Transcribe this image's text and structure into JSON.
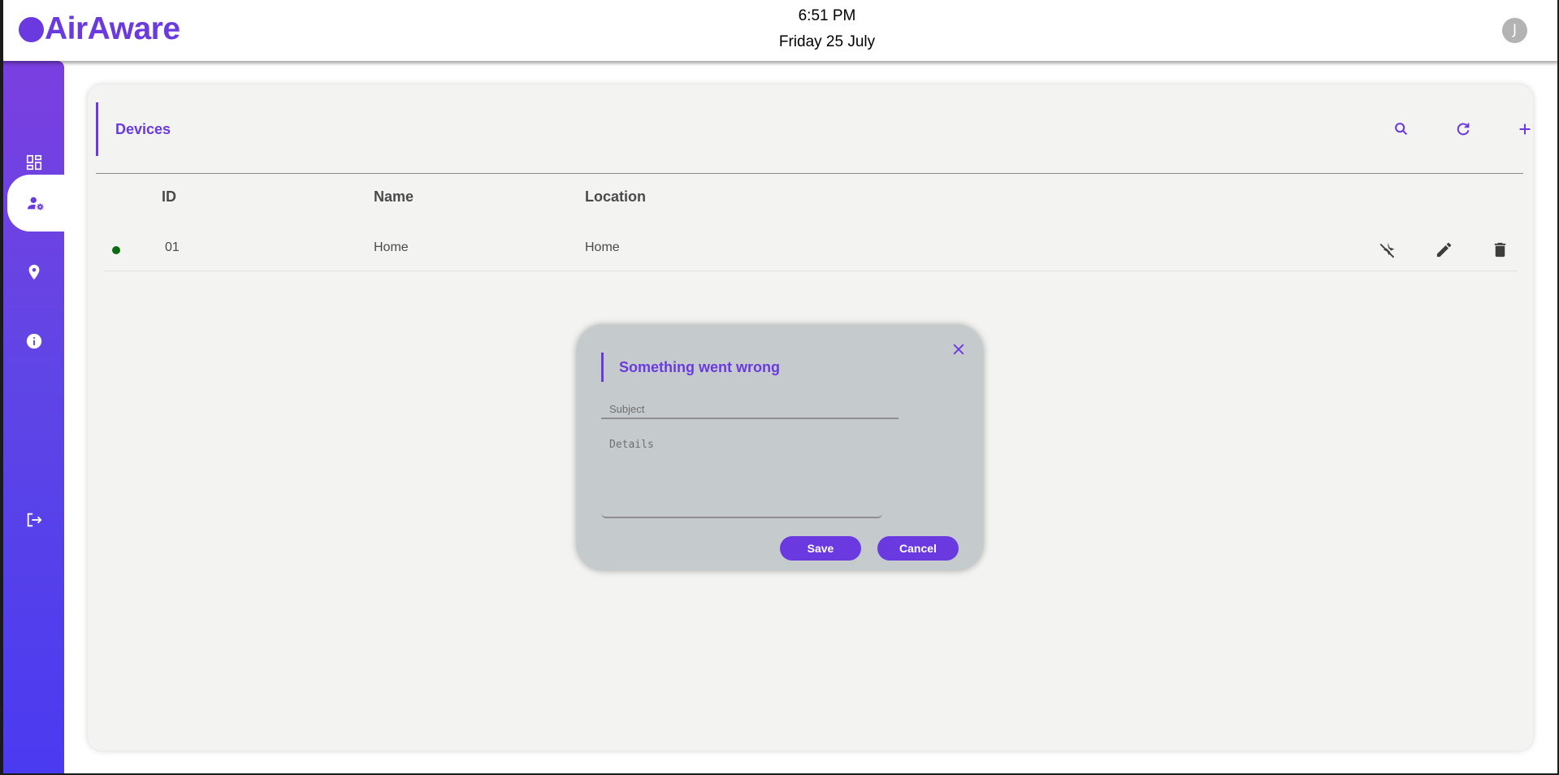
{
  "header": {
    "logo_text": "AirAware",
    "time": "6:51 PM",
    "date": "Friday 25 July",
    "avatar_initial": "J"
  },
  "sidebar": {
    "items": [
      {
        "icon": "dashboard-icon",
        "active": false
      },
      {
        "icon": "user-settings-icon",
        "active": true
      },
      {
        "icon": "location-pin-icon",
        "active": false
      },
      {
        "icon": "info-icon",
        "active": false
      },
      {
        "icon": "logout-icon",
        "active": false
      }
    ]
  },
  "devices": {
    "title": "Devices",
    "actions": [
      "search-icon",
      "refresh-icon",
      "add-icon"
    ],
    "columns": {
      "id": "ID",
      "name": "Name",
      "location": "Location"
    },
    "rows": [
      {
        "status": "online",
        "id": "01",
        "name": "Home",
        "location": "Home",
        "actions": [
          "notifications-off-icon",
          "edit-icon",
          "delete-icon"
        ]
      }
    ]
  },
  "modal": {
    "title": "Something went wrong",
    "subject_placeholder": "Subject",
    "details_placeholder": "Details",
    "save_label": "Save",
    "cancel_label": "Cancel"
  },
  "colors": {
    "accent": "#6a3ae0",
    "status_online": "#0d6b12",
    "modal_bg": "#c5cbcd",
    "card_bg": "#f3f3f1"
  }
}
